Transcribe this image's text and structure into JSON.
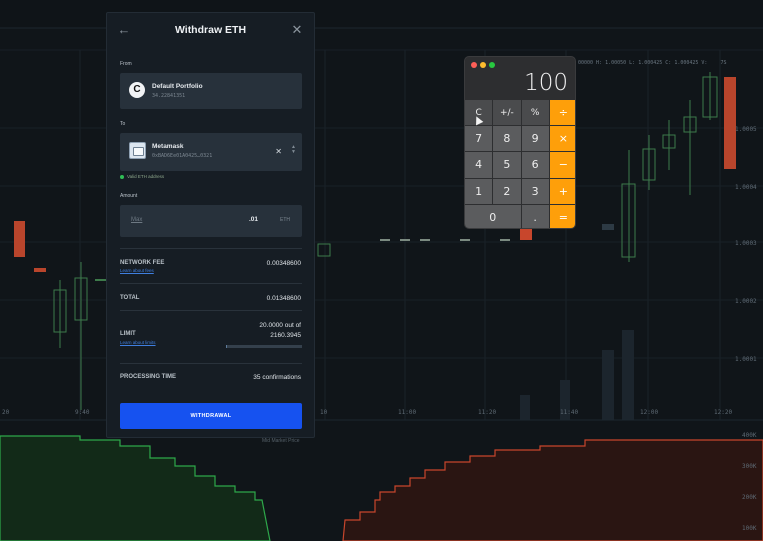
{
  "modal": {
    "title": "Withdraw ETH",
    "back_icon": "arrow-left-icon",
    "close_icon": "close-icon",
    "from_label": "From",
    "from_name": "Default Portfolio",
    "from_balance": "34.22841351",
    "to_label": "To",
    "to_name": "Metamask",
    "to_address": "0xBAD6Ee01A0425…0321",
    "valid_text": "Valid ETH address",
    "amount_label": "Amount",
    "max_label": "Max",
    "amount_value": ".01",
    "amount_unit": "ETH",
    "network_fee_label": "NETWORK FEE",
    "network_fee_link": "Learn about fees",
    "network_fee_value": "0.00348600",
    "total_label": "TOTAL",
    "total_value": "0.01348600",
    "limit_label": "LIMIT",
    "limit_link": "Learn about limits",
    "limit_value": "20.0000 out of",
    "limit_total": "2160.3945",
    "limit_used_fraction": 0.009,
    "processing_label": "PROCESSING TIME",
    "processing_value": "35 confirmations",
    "withdraw_button": "WITHDRAWAL"
  },
  "calculator": {
    "display": "100",
    "keys": [
      "C",
      "+/-",
      "%",
      "÷",
      "7",
      "8",
      "9",
      "×",
      "4",
      "5",
      "6",
      "−",
      "1",
      "2",
      "3",
      "+",
      "0",
      ".",
      "="
    ]
  },
  "background": {
    "ohlc_text": "00000  H: 1.00050  L: 1.000425  C: 1.000425  V:",
    "timeframe": "7S",
    "price_ticks": [
      "1.0005",
      "1.0004",
      "1.0003",
      "1.0002",
      "1.0001"
    ],
    "time_ticks": [
      "20",
      "9:40",
      "10",
      "11:00",
      "11:20",
      "11:40",
      "12:00",
      "12:20"
    ],
    "depth_ticks": [
      "400K",
      "300K",
      "200K",
      "100K"
    ],
    "depth_label": "Mid Market Price",
    "colors": {
      "up": "#2ea84a",
      "down": "#c8462c",
      "accent": "#1652f0"
    }
  }
}
